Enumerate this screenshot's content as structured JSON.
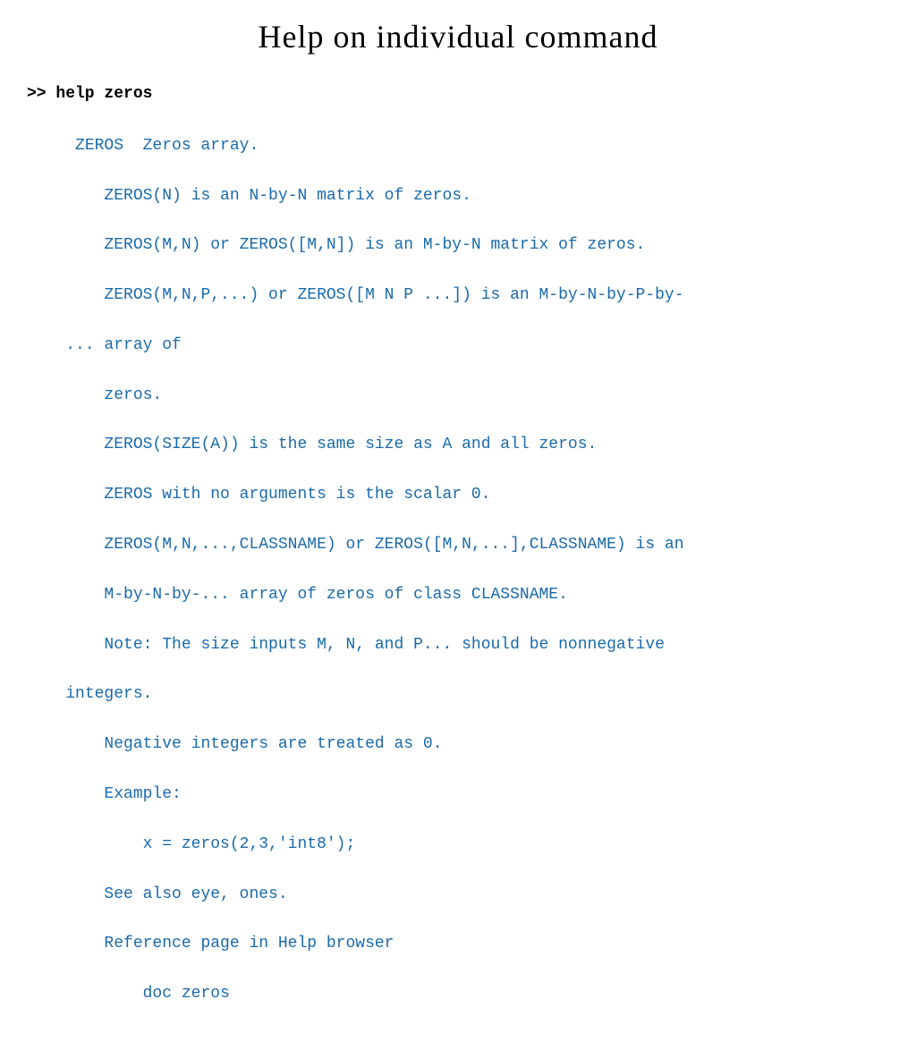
{
  "page": {
    "title": "Help on individual command",
    "prompt": ">> help zeros",
    "help_content": [
      {
        "type": "header",
        "text": " ZEROS  Zeros array."
      },
      {
        "type": "body",
        "text": "    ZEROS(N) is an N-by-N matrix of zeros."
      },
      {
        "type": "body",
        "text": "    ZEROS(M,N) or ZEROS([M,N]) is an M-by-N matrix of zeros."
      },
      {
        "type": "body",
        "text": "    ZEROS(M,N,P,...) or ZEROS([M N P ...]) is an M-by-N-by-P-by-"
      },
      {
        "type": "body",
        "text": "... array of"
      },
      {
        "type": "body",
        "text": "    zeros."
      },
      {
        "type": "body",
        "text": "    ZEROS(SIZE(A)) is the same size as A and all zeros."
      },
      {
        "type": "body",
        "text": "    ZEROS with no arguments is the scalar 0."
      },
      {
        "type": "body",
        "text": "    ZEROS(M,N,...,CLASSNAME) or ZEROS([M,N,...],CLASSNAME) is an"
      },
      {
        "type": "body",
        "text": "    M-by-N-by-... array of zeros of class CLASSNAME."
      },
      {
        "type": "body",
        "text": "    Note: The size inputs M, N, and P... should be nonnegative"
      },
      {
        "type": "body",
        "text": "integers."
      },
      {
        "type": "body",
        "text": "    Negative integers are treated as 0."
      },
      {
        "type": "body",
        "text": "    Example:"
      },
      {
        "type": "body",
        "text": "        x = zeros(2,3,'int8');"
      },
      {
        "type": "body",
        "text": "    See also eye, ones."
      },
      {
        "type": "body",
        "text": "    Reference page in Help browser"
      },
      {
        "type": "body",
        "text": "        doc zeros"
      }
    ]
  }
}
